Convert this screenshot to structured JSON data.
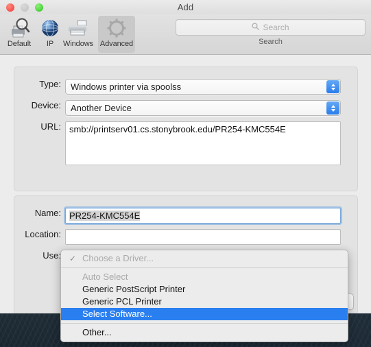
{
  "window": {
    "title": "Add",
    "traffic_lights": [
      {
        "name": "close",
        "color": "#f4524a"
      },
      {
        "name": "minimize",
        "color": "#c8c8c8"
      },
      {
        "name": "zoom",
        "color": "#4ad23a"
      }
    ]
  },
  "toolbar": {
    "items": [
      {
        "label": "Default",
        "icon": "printer-magnifier-icon",
        "selected": false
      },
      {
        "label": "IP",
        "icon": "globe-icon",
        "selected": false
      },
      {
        "label": "Windows",
        "icon": "printer-icon",
        "selected": false
      },
      {
        "label": "Advanced",
        "icon": "gear-icon",
        "selected": true
      }
    ],
    "search": {
      "icon": "search-icon",
      "placeholder": "Search",
      "value": "",
      "label": "Search"
    }
  },
  "form": {
    "type": {
      "label": "Type:",
      "value": "Windows printer via spoolss"
    },
    "device": {
      "label": "Device:",
      "value": "Another Device"
    },
    "url": {
      "label": "URL:",
      "value": "smb://printserv01.cs.stonybrook.edu/PR254-KMC554E"
    },
    "name": {
      "label": "Name:",
      "value": "PR254-KMC554E",
      "selected": true,
      "focused": true
    },
    "location": {
      "label": "Location:",
      "value": ""
    },
    "use": {
      "label": "Use:",
      "value": "Choose a Driver..."
    }
  },
  "add_button": {
    "label": ""
  },
  "driver_menu": {
    "open": true,
    "highlight_color": "#2a7ff0",
    "items": [
      {
        "label": "Choose a Driver...",
        "checked": true,
        "disabled": true,
        "selected": false,
        "separator_after": true
      },
      {
        "label": "Auto Select",
        "checked": false,
        "disabled": true,
        "selected": false,
        "separator_after": false
      },
      {
        "label": "Generic PostScript Printer",
        "checked": false,
        "disabled": false,
        "selected": false,
        "separator_after": false
      },
      {
        "label": "Generic PCL Printer",
        "checked": false,
        "disabled": false,
        "selected": false,
        "separator_after": false
      },
      {
        "label": "Select Software...",
        "checked": false,
        "disabled": false,
        "selected": true,
        "separator_after": true
      },
      {
        "label": "Other...",
        "checked": false,
        "disabled": false,
        "selected": false,
        "separator_after": false
      }
    ],
    "check_glyph": "✓"
  }
}
